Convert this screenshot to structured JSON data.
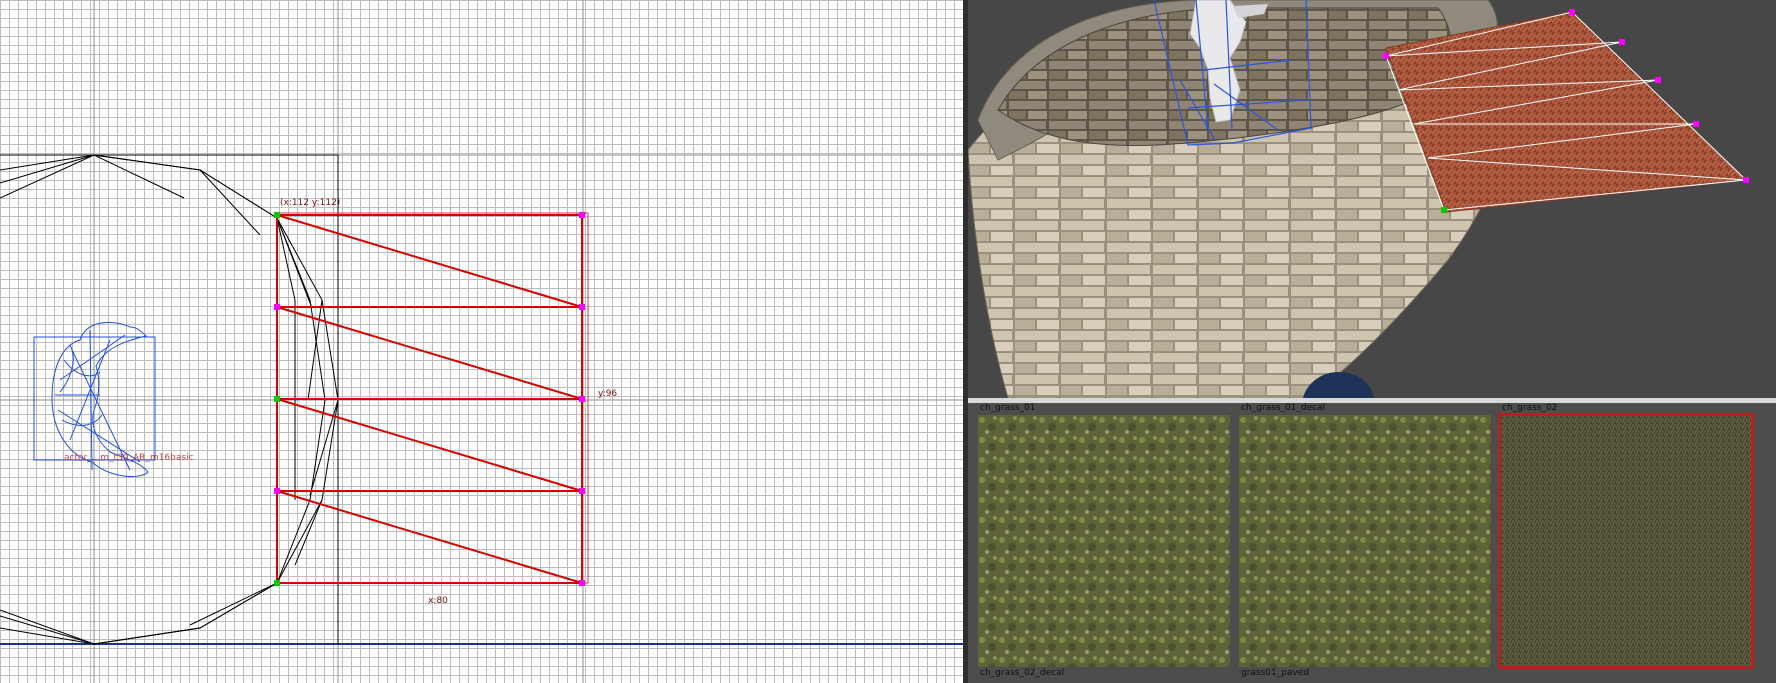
{
  "grid_view": {
    "vertex_coord_label": "(x:112  y:112)",
    "height_dimension_label": "y:96",
    "width_dimension_label": "x:80",
    "entity_label": "actor_...m_t30_AR_m16basic",
    "colors": {
      "selection_edges": "#d40000",
      "vertex_handle": "#ff00ff",
      "selected_vertex": "#00cc00",
      "entity_wire": "#1f4fe0",
      "ground_line": "#1830a0"
    }
  },
  "viewport_3d": {
    "colors": {
      "background": "#474747",
      "brush_wire": "#ffffff",
      "patch_surface": "#a14e35"
    }
  },
  "texture_browser": {
    "items": [
      {
        "name": "ch_grass_01",
        "selected": false
      },
      {
        "name": "ch_grass_01_decal",
        "selected": false
      },
      {
        "name": "ch_grass_02",
        "selected": true
      },
      {
        "name": "ch_grass_02_decal",
        "selected": false
      },
      {
        "name": "grass01_paved",
        "selected": false
      }
    ]
  }
}
